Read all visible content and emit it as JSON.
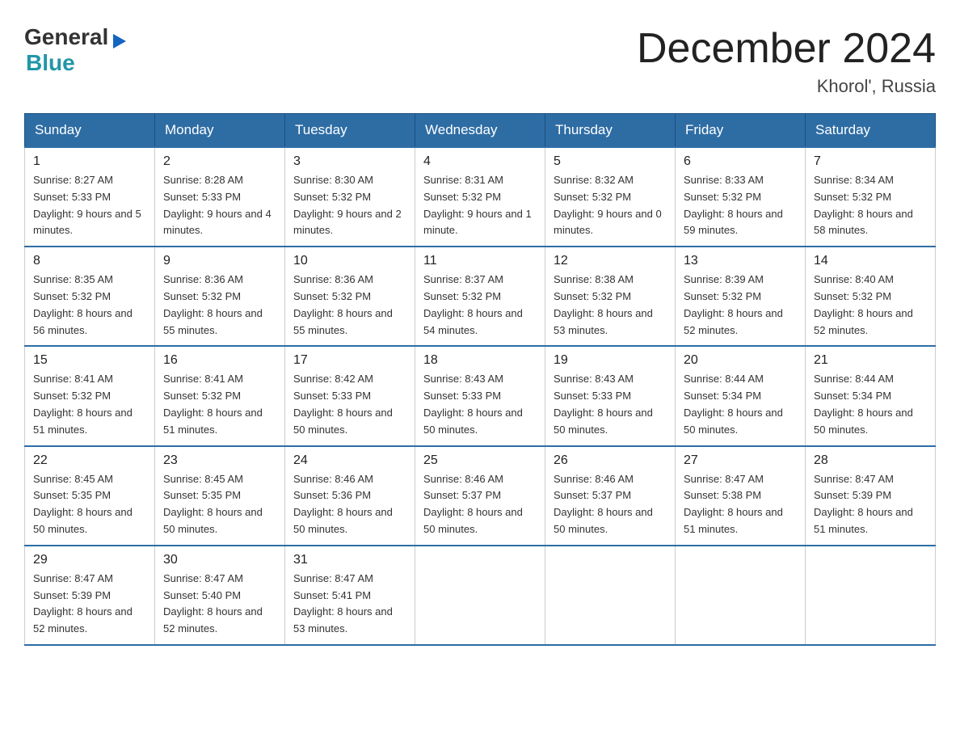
{
  "header": {
    "logo_general": "General",
    "logo_blue": "Blue",
    "month_title": "December 2024",
    "location": "Khorol', Russia"
  },
  "days_of_week": [
    "Sunday",
    "Monday",
    "Tuesday",
    "Wednesday",
    "Thursday",
    "Friday",
    "Saturday"
  ],
  "weeks": [
    [
      {
        "day": "1",
        "sunrise": "8:27 AM",
        "sunset": "5:33 PM",
        "daylight": "9 hours and 5 minutes."
      },
      {
        "day": "2",
        "sunrise": "8:28 AM",
        "sunset": "5:33 PM",
        "daylight": "9 hours and 4 minutes."
      },
      {
        "day": "3",
        "sunrise": "8:30 AM",
        "sunset": "5:32 PM",
        "daylight": "9 hours and 2 minutes."
      },
      {
        "day": "4",
        "sunrise": "8:31 AM",
        "sunset": "5:32 PM",
        "daylight": "9 hours and 1 minute."
      },
      {
        "day": "5",
        "sunrise": "8:32 AM",
        "sunset": "5:32 PM",
        "daylight": "9 hours and 0 minutes."
      },
      {
        "day": "6",
        "sunrise": "8:33 AM",
        "sunset": "5:32 PM",
        "daylight": "8 hours and 59 minutes."
      },
      {
        "day": "7",
        "sunrise": "8:34 AM",
        "sunset": "5:32 PM",
        "daylight": "8 hours and 58 minutes."
      }
    ],
    [
      {
        "day": "8",
        "sunrise": "8:35 AM",
        "sunset": "5:32 PM",
        "daylight": "8 hours and 56 minutes."
      },
      {
        "day": "9",
        "sunrise": "8:36 AM",
        "sunset": "5:32 PM",
        "daylight": "8 hours and 55 minutes."
      },
      {
        "day": "10",
        "sunrise": "8:36 AM",
        "sunset": "5:32 PM",
        "daylight": "8 hours and 55 minutes."
      },
      {
        "day": "11",
        "sunrise": "8:37 AM",
        "sunset": "5:32 PM",
        "daylight": "8 hours and 54 minutes."
      },
      {
        "day": "12",
        "sunrise": "8:38 AM",
        "sunset": "5:32 PM",
        "daylight": "8 hours and 53 minutes."
      },
      {
        "day": "13",
        "sunrise": "8:39 AM",
        "sunset": "5:32 PM",
        "daylight": "8 hours and 52 minutes."
      },
      {
        "day": "14",
        "sunrise": "8:40 AM",
        "sunset": "5:32 PM",
        "daylight": "8 hours and 52 minutes."
      }
    ],
    [
      {
        "day": "15",
        "sunrise": "8:41 AM",
        "sunset": "5:32 PM",
        "daylight": "8 hours and 51 minutes."
      },
      {
        "day": "16",
        "sunrise": "8:41 AM",
        "sunset": "5:32 PM",
        "daylight": "8 hours and 51 minutes."
      },
      {
        "day": "17",
        "sunrise": "8:42 AM",
        "sunset": "5:33 PM",
        "daylight": "8 hours and 50 minutes."
      },
      {
        "day": "18",
        "sunrise": "8:43 AM",
        "sunset": "5:33 PM",
        "daylight": "8 hours and 50 minutes."
      },
      {
        "day": "19",
        "sunrise": "8:43 AM",
        "sunset": "5:33 PM",
        "daylight": "8 hours and 50 minutes."
      },
      {
        "day": "20",
        "sunrise": "8:44 AM",
        "sunset": "5:34 PM",
        "daylight": "8 hours and 50 minutes."
      },
      {
        "day": "21",
        "sunrise": "8:44 AM",
        "sunset": "5:34 PM",
        "daylight": "8 hours and 50 minutes."
      }
    ],
    [
      {
        "day": "22",
        "sunrise": "8:45 AM",
        "sunset": "5:35 PM",
        "daylight": "8 hours and 50 minutes."
      },
      {
        "day": "23",
        "sunrise": "8:45 AM",
        "sunset": "5:35 PM",
        "daylight": "8 hours and 50 minutes."
      },
      {
        "day": "24",
        "sunrise": "8:46 AM",
        "sunset": "5:36 PM",
        "daylight": "8 hours and 50 minutes."
      },
      {
        "day": "25",
        "sunrise": "8:46 AM",
        "sunset": "5:37 PM",
        "daylight": "8 hours and 50 minutes."
      },
      {
        "day": "26",
        "sunrise": "8:46 AM",
        "sunset": "5:37 PM",
        "daylight": "8 hours and 50 minutes."
      },
      {
        "day": "27",
        "sunrise": "8:47 AM",
        "sunset": "5:38 PM",
        "daylight": "8 hours and 51 minutes."
      },
      {
        "day": "28",
        "sunrise": "8:47 AM",
        "sunset": "5:39 PM",
        "daylight": "8 hours and 51 minutes."
      }
    ],
    [
      {
        "day": "29",
        "sunrise": "8:47 AM",
        "sunset": "5:39 PM",
        "daylight": "8 hours and 52 minutes."
      },
      {
        "day": "30",
        "sunrise": "8:47 AM",
        "sunset": "5:40 PM",
        "daylight": "8 hours and 52 minutes."
      },
      {
        "day": "31",
        "sunrise": "8:47 AM",
        "sunset": "5:41 PM",
        "daylight": "8 hours and 53 minutes."
      },
      null,
      null,
      null,
      null
    ]
  ],
  "labels": {
    "sunrise": "Sunrise:",
    "sunset": "Sunset:",
    "daylight": "Daylight:"
  }
}
